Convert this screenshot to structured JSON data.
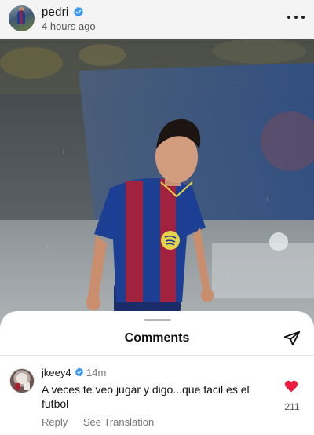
{
  "post": {
    "username": "pedri",
    "time_ago": "4 hours ago"
  },
  "photo": {
    "subject": "football-player-photo"
  },
  "comments_sheet": {
    "title": "Comments",
    "comments": [
      {
        "username": "jkeey4",
        "time": "14m",
        "text": "A veces te veo jugar y digo...que facil es el futbol",
        "likes": "211",
        "reply_label": "Reply",
        "translate_label": "See Translation"
      }
    ]
  },
  "colors": {
    "verified_blue": "#3897f0",
    "like_red": "#ee1d3f",
    "header_bg": "#f4f4f5",
    "kit_blue": "#1c3f93",
    "kit_garnet": "#a0223f"
  },
  "icons": [
    "verified-badge-icon",
    "more-options-icon",
    "send-icon",
    "heart-icon"
  ]
}
